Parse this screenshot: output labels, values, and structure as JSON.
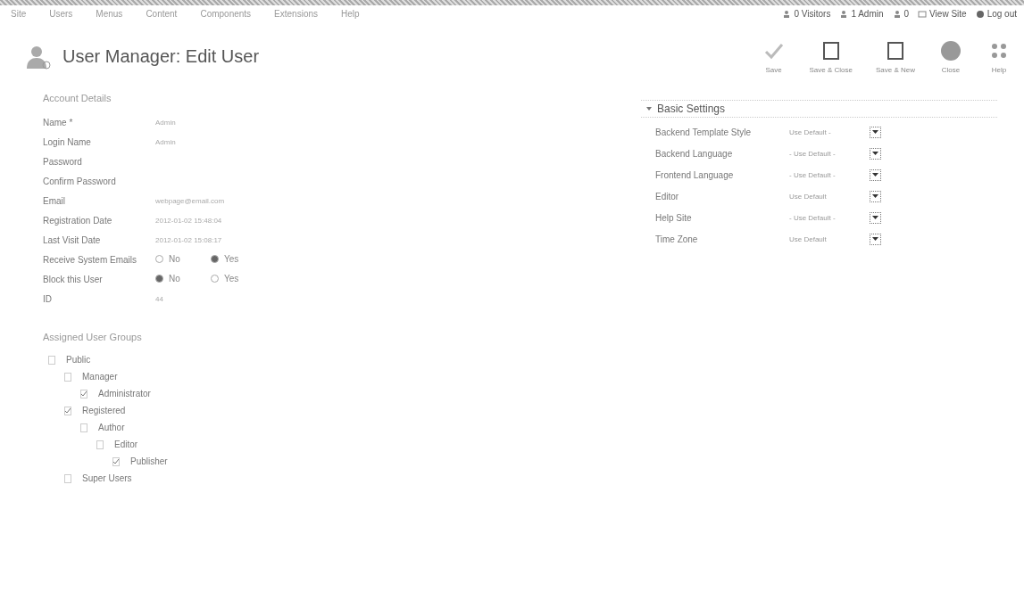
{
  "menu": [
    "Site",
    "Users",
    "Menus",
    "Content",
    "Components",
    "Extensions",
    "Help"
  ],
  "status": [
    {
      "kind": "visitors",
      "label": "0 Visitors"
    },
    {
      "kind": "admin",
      "label": "1 Admin"
    },
    {
      "kind": "messages",
      "label": "0"
    },
    {
      "kind": "view",
      "label": "View Site"
    },
    {
      "kind": "logout",
      "label": "Log out"
    }
  ],
  "title": "User Manager: Edit User",
  "toolbar": [
    {
      "kind": "save",
      "label": "Save"
    },
    {
      "kind": "save-close",
      "label": "Save & Close"
    },
    {
      "kind": "save-new",
      "label": "Save & New"
    },
    {
      "kind": "close",
      "label": "Close"
    },
    {
      "kind": "help",
      "label": "Help"
    }
  ],
  "account": {
    "title": "Account Details",
    "fields": [
      {
        "kind": "text",
        "label": "Name *",
        "value": "Admin"
      },
      {
        "kind": "text",
        "label": "Login Name",
        "value": "Admin"
      },
      {
        "kind": "password",
        "label": "Password"
      },
      {
        "kind": "password",
        "label": "Confirm Password"
      },
      {
        "kind": "text",
        "label": "Email",
        "value": "webpage@email.com"
      },
      {
        "kind": "text",
        "label": "Registration Date",
        "value": "2012-01-02 15:48:04"
      },
      {
        "kind": "text",
        "label": "Last Visit Date",
        "value": "2012-01-02 15:08:17"
      },
      {
        "kind": "radio",
        "label": "Receive System Emails",
        "options": [
          {
            "label": "No",
            "selected": false
          },
          {
            "label": "Yes",
            "selected": true
          }
        ]
      },
      {
        "kind": "radio",
        "label": "Block this User",
        "options": [
          {
            "label": "No",
            "selected": true
          },
          {
            "label": "Yes",
            "selected": false
          }
        ]
      },
      {
        "kind": "text",
        "label": "ID",
        "value": "44"
      }
    ]
  },
  "groups": {
    "title": "Assigned User Groups",
    "items": [
      {
        "label": "Public",
        "checked": false,
        "children": [
          {
            "label": "Manager",
            "checked": false,
            "children": [
              {
                "label": "Administrator",
                "checked": true
              }
            ]
          },
          {
            "label": "Registered",
            "checked": true,
            "children": [
              {
                "label": "Author",
                "checked": false,
                "children": [
                  {
                    "label": "Editor",
                    "checked": false,
                    "children": [
                      {
                        "label": "Publisher",
                        "checked": true
                      }
                    ]
                  }
                ]
              }
            ]
          },
          {
            "label": "Super Users",
            "checked": false
          }
        ]
      }
    ]
  },
  "settings": {
    "title": "Basic Settings",
    "expanded": true,
    "fields": [
      {
        "label": "Backend Template Style",
        "value": "Use Default -"
      },
      {
        "label": "Backend Language",
        "value": "- Use Default -"
      },
      {
        "label": "Frontend Language",
        "value": "- Use Default -"
      },
      {
        "label": "Editor",
        "value": "Use Default"
      },
      {
        "label": "Help Site",
        "value": "- Use Default -"
      },
      {
        "label": "Time Zone",
        "value": "Use Default"
      }
    ]
  }
}
